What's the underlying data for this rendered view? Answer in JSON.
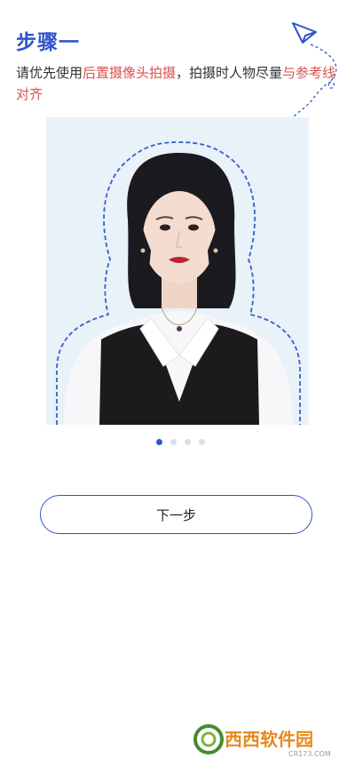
{
  "header": {
    "title": "步骤一"
  },
  "instruction": {
    "part1": "请优先使用",
    "highlight1": "后置摄像头拍摄",
    "part2": "，拍摄时人物尽量",
    "highlight2": "与参考线对齐"
  },
  "carousel": {
    "total": 4,
    "active_index": 0
  },
  "actions": {
    "next_label": "下一步"
  },
  "watermark": {
    "text": "西西软件园",
    "subtext": "CR173.COM"
  },
  "colors": {
    "accent": "#2f55c8",
    "highlight": "#d9534f"
  }
}
